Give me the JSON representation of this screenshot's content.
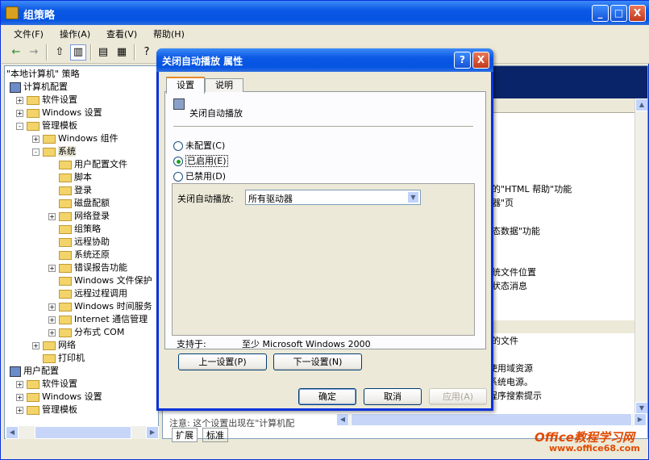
{
  "window": {
    "title": "组策略",
    "min": "_",
    "max": "□",
    "close": "X"
  },
  "menu": [
    "文件(F)",
    "操作(A)",
    "查看(V)",
    "帮助(H)"
  ],
  "tree": [
    {
      "label": "\"本地计算机\" 策略",
      "kind": "root"
    },
    {
      "label": "计算机配置",
      "kind": "comp"
    },
    {
      "label": "软件设置",
      "kind": "folder",
      "exp": "+"
    },
    {
      "label": "Windows 设置",
      "kind": "folder",
      "exp": "+"
    },
    {
      "label": "管理模板",
      "kind": "folder",
      "exp": "-"
    },
    {
      "label": "Windows 组件",
      "kind": "folder",
      "exp": "+"
    },
    {
      "label": "系统",
      "kind": "folder",
      "exp": "-"
    },
    {
      "label": "用户配置文件",
      "kind": "folder"
    },
    {
      "label": "脚本",
      "kind": "folder"
    },
    {
      "label": "登录",
      "kind": "folder"
    },
    {
      "label": "磁盘配额",
      "kind": "folder"
    },
    {
      "label": "网络登录",
      "kind": "folder",
      "exp": "+"
    },
    {
      "label": "组策略",
      "kind": "folder"
    },
    {
      "label": "远程协助",
      "kind": "folder"
    },
    {
      "label": "系统还原",
      "kind": "folder"
    },
    {
      "label": "错误报告功能",
      "kind": "folder",
      "exp": "+"
    },
    {
      "label": "Windows 文件保护",
      "kind": "folder"
    },
    {
      "label": "远程过程调用",
      "kind": "folder"
    },
    {
      "label": "Windows 时间服务",
      "kind": "folder",
      "exp": "+"
    },
    {
      "label": "Internet 通信管理",
      "kind": "folder",
      "exp": "+"
    },
    {
      "label": "分布式 COM",
      "kind": "folder",
      "exp": "+"
    },
    {
      "label": "网络",
      "kind": "folder",
      "exp": "+"
    },
    {
      "label": "打印机",
      "kind": "folder"
    },
    {
      "label": "用户配置",
      "kind": "comp"
    },
    {
      "label": "软件设置",
      "kind": "folder",
      "exp": "+"
    },
    {
      "label": "Windows 设置",
      "kind": "folder",
      "exp": "+"
    },
    {
      "label": "管理模板",
      "kind": "folder",
      "exp": "+"
    }
  ],
  "right_items": [
    "的\"HTML 帮助\"功能",
    "器\"页",
    "态数据\"功能",
    "统文件位置",
    "状态消息",
    "的文件",
    "使用域资源",
    "系统电源。",
    "程序搜索提示"
  ],
  "right_note": "注意: 这个设置出现在\"计算机配",
  "bottom_tabs": [
    "扩展",
    "标准"
  ],
  "dialog": {
    "title": "关闭自动播放 属性",
    "help": "?",
    "close": "X",
    "tabs": [
      "设置",
      "说明"
    ],
    "setting_name": "关闭自动播放",
    "options": [
      {
        "label": "未配置(C)",
        "checked": false
      },
      {
        "label": "已启用(E)",
        "checked": true
      },
      {
        "label": "已禁用(D)",
        "checked": false
      }
    ],
    "combo_label": "关闭自动播放:",
    "combo_value": "所有驱动器",
    "supported_label": "支持于:",
    "supported_value": "至少 Microsoft Windows 2000",
    "prev": "上一设置(P)",
    "next": "下一设置(N)",
    "ok": "确定",
    "cancel": "取消",
    "apply": "应用(A)"
  },
  "watermark": {
    "brand": "Office教程学习网",
    "url": "www.office68.com"
  }
}
